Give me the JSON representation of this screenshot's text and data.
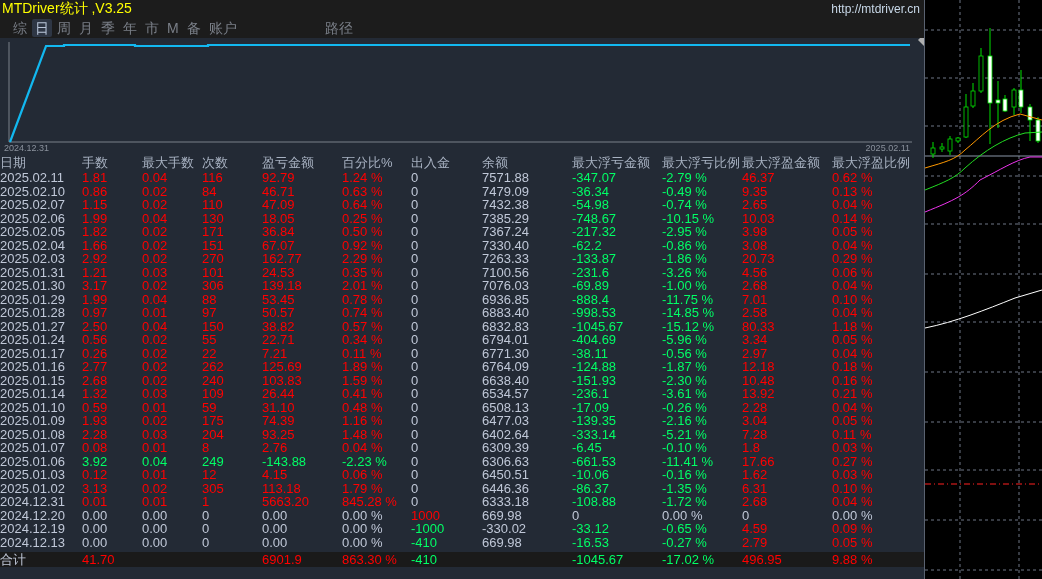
{
  "title": "MTDriver统计 ,V3.25",
  "url": "http://mtdriver.cn",
  "tabs": [
    {
      "label": "综",
      "selected": false
    },
    {
      "label": "日",
      "selected": true
    },
    {
      "label": "周",
      "selected": false
    },
    {
      "label": "月",
      "selected": false
    },
    {
      "label": "季",
      "selected": false
    },
    {
      "label": "年",
      "selected": false
    },
    {
      "label": "市",
      "selected": false
    },
    {
      "label": "M",
      "selected": false
    },
    {
      "label": "备",
      "selected": false
    },
    {
      "label": "账户",
      "selected": false
    }
  ],
  "path_button": "路径",
  "equity_chart": {
    "start_label": "2024.12.31",
    "end_label": "2025.02.11"
  },
  "table": {
    "columns": [
      "日期",
      "手数",
      "最大手数",
      "次数",
      "盈亏金额",
      "百分比%",
      "出入金",
      "余额",
      "最大浮亏金额",
      "最大浮亏比例",
      "最大浮盈金额",
      "最大浮盈比例"
    ],
    "rows": [
      {
        "cells": [
          {
            "text": "2025.02.11",
            "color": "#c0c8d8"
          },
          {
            "text": "1.81",
            "color": "#ff0000"
          },
          {
            "text": "0.04",
            "color": "#ff0000"
          },
          {
            "text": "116",
            "color": "#ff0000"
          },
          {
            "text": "92.79",
            "color": "#ff0000"
          },
          {
            "text": "1.24 %",
            "color": "#ff0000"
          },
          {
            "text": "0",
            "color": "#c0c8d8"
          },
          {
            "text": "7571.88",
            "color": "#c0c8d8"
          },
          {
            "text": "-347.07",
            "color": "#00ff66"
          },
          {
            "text": "-2.79 %",
            "color": "#00ff66"
          },
          {
            "text": "46.37",
            "color": "#ff0000"
          },
          {
            "text": "0.62 %",
            "color": "#ff0000"
          }
        ]
      },
      {
        "cells": [
          {
            "text": "2025.02.10",
            "color": "#c0c8d8"
          },
          {
            "text": "0.86",
            "color": "#ff0000"
          },
          {
            "text": "0.02",
            "color": "#ff0000"
          },
          {
            "text": "84",
            "color": "#ff0000"
          },
          {
            "text": "46.71",
            "color": "#ff0000"
          },
          {
            "text": "0.63 %",
            "color": "#ff0000"
          },
          {
            "text": "0",
            "color": "#c0c8d8"
          },
          {
            "text": "7479.09",
            "color": "#c0c8d8"
          },
          {
            "text": "-36.34",
            "color": "#00ff66"
          },
          {
            "text": "-0.49 %",
            "color": "#00ff66"
          },
          {
            "text": "9.35",
            "color": "#ff0000"
          },
          {
            "text": "0.13 %",
            "color": "#ff0000"
          }
        ]
      },
      {
        "cells": [
          {
            "text": "2025.02.07",
            "color": "#c0c8d8"
          },
          {
            "text": "1.15",
            "color": "#ff0000"
          },
          {
            "text": "0.02",
            "color": "#ff0000"
          },
          {
            "text": "110",
            "color": "#ff0000"
          },
          {
            "text": "47.09",
            "color": "#ff0000"
          },
          {
            "text": "0.64 %",
            "color": "#ff0000"
          },
          {
            "text": "0",
            "color": "#c0c8d8"
          },
          {
            "text": "7432.38",
            "color": "#c0c8d8"
          },
          {
            "text": "-54.98",
            "color": "#00ff66"
          },
          {
            "text": "-0.74 %",
            "color": "#00ff66"
          },
          {
            "text": "2.65",
            "color": "#ff0000"
          },
          {
            "text": "0.04 %",
            "color": "#ff0000"
          }
        ]
      },
      {
        "cells": [
          {
            "text": "2025.02.06",
            "color": "#c0c8d8"
          },
          {
            "text": "1.99",
            "color": "#ff0000"
          },
          {
            "text": "0.04",
            "color": "#ff0000"
          },
          {
            "text": "130",
            "color": "#ff0000"
          },
          {
            "text": "18.05",
            "color": "#ff0000"
          },
          {
            "text": "0.25 %",
            "color": "#ff0000"
          },
          {
            "text": "0",
            "color": "#c0c8d8"
          },
          {
            "text": "7385.29",
            "color": "#c0c8d8"
          },
          {
            "text": "-748.67",
            "color": "#00ff66"
          },
          {
            "text": "-10.15 %",
            "color": "#00ff66"
          },
          {
            "text": "10.03",
            "color": "#ff0000"
          },
          {
            "text": "0.14 %",
            "color": "#ff0000"
          }
        ]
      },
      {
        "cells": [
          {
            "text": "2025.02.05",
            "color": "#c0c8d8"
          },
          {
            "text": "1.82",
            "color": "#ff0000"
          },
          {
            "text": "0.02",
            "color": "#ff0000"
          },
          {
            "text": "171",
            "color": "#ff0000"
          },
          {
            "text": "36.84",
            "color": "#ff0000"
          },
          {
            "text": "0.50 %",
            "color": "#ff0000"
          },
          {
            "text": "0",
            "color": "#c0c8d8"
          },
          {
            "text": "7367.24",
            "color": "#c0c8d8"
          },
          {
            "text": "-217.32",
            "color": "#00ff66"
          },
          {
            "text": "-2.95 %",
            "color": "#00ff66"
          },
          {
            "text": "3.98",
            "color": "#ff0000"
          },
          {
            "text": "0.05 %",
            "color": "#ff0000"
          }
        ]
      },
      {
        "cells": [
          {
            "text": "2025.02.04",
            "color": "#c0c8d8"
          },
          {
            "text": "1.66",
            "color": "#ff0000"
          },
          {
            "text": "0.02",
            "color": "#ff0000"
          },
          {
            "text": "151",
            "color": "#ff0000"
          },
          {
            "text": "67.07",
            "color": "#ff0000"
          },
          {
            "text": "0.92 %",
            "color": "#ff0000"
          },
          {
            "text": "0",
            "color": "#c0c8d8"
          },
          {
            "text": "7330.40",
            "color": "#c0c8d8"
          },
          {
            "text": "-62.2",
            "color": "#00ff66"
          },
          {
            "text": "-0.86 %",
            "color": "#00ff66"
          },
          {
            "text": "3.08",
            "color": "#ff0000"
          },
          {
            "text": "0.04 %",
            "color": "#ff0000"
          }
        ]
      },
      {
        "cells": [
          {
            "text": "2025.02.03",
            "color": "#c0c8d8"
          },
          {
            "text": "2.92",
            "color": "#ff0000"
          },
          {
            "text": "0.02",
            "color": "#ff0000"
          },
          {
            "text": "270",
            "color": "#ff0000"
          },
          {
            "text": "162.77",
            "color": "#ff0000"
          },
          {
            "text": "2.29 %",
            "color": "#ff0000"
          },
          {
            "text": "0",
            "color": "#c0c8d8"
          },
          {
            "text": "7263.33",
            "color": "#c0c8d8"
          },
          {
            "text": "-133.87",
            "color": "#00ff66"
          },
          {
            "text": "-1.86 %",
            "color": "#00ff66"
          },
          {
            "text": "20.73",
            "color": "#ff0000"
          },
          {
            "text": "0.29 %",
            "color": "#ff0000"
          }
        ]
      },
      {
        "cells": [
          {
            "text": "2025.01.31",
            "color": "#c0c8d8"
          },
          {
            "text": "1.21",
            "color": "#ff0000"
          },
          {
            "text": "0.03",
            "color": "#ff0000"
          },
          {
            "text": "101",
            "color": "#ff0000"
          },
          {
            "text": "24.53",
            "color": "#ff0000"
          },
          {
            "text": "0.35 %",
            "color": "#ff0000"
          },
          {
            "text": "0",
            "color": "#c0c8d8"
          },
          {
            "text": "7100.56",
            "color": "#c0c8d8"
          },
          {
            "text": "-231.6",
            "color": "#00ff66"
          },
          {
            "text": "-3.26 %",
            "color": "#00ff66"
          },
          {
            "text": "4.56",
            "color": "#ff0000"
          },
          {
            "text": "0.06 %",
            "color": "#ff0000"
          }
        ]
      },
      {
        "cells": [
          {
            "text": "2025.01.30",
            "color": "#c0c8d8"
          },
          {
            "text": "3.17",
            "color": "#ff0000"
          },
          {
            "text": "0.02",
            "color": "#ff0000"
          },
          {
            "text": "306",
            "color": "#ff0000"
          },
          {
            "text": "139.18",
            "color": "#ff0000"
          },
          {
            "text": "2.01 %",
            "color": "#ff0000"
          },
          {
            "text": "0",
            "color": "#c0c8d8"
          },
          {
            "text": "7076.03",
            "color": "#c0c8d8"
          },
          {
            "text": "-69.89",
            "color": "#00ff66"
          },
          {
            "text": "-1.00 %",
            "color": "#00ff66"
          },
          {
            "text": "2.68",
            "color": "#ff0000"
          },
          {
            "text": "0.04 %",
            "color": "#ff0000"
          }
        ]
      },
      {
        "cells": [
          {
            "text": "2025.01.29",
            "color": "#c0c8d8"
          },
          {
            "text": "1.99",
            "color": "#ff0000"
          },
          {
            "text": "0.04",
            "color": "#ff0000"
          },
          {
            "text": "88",
            "color": "#ff0000"
          },
          {
            "text": "53.45",
            "color": "#ff0000"
          },
          {
            "text": "0.78 %",
            "color": "#ff0000"
          },
          {
            "text": "0",
            "color": "#c0c8d8"
          },
          {
            "text": "6936.85",
            "color": "#c0c8d8"
          },
          {
            "text": "-888.4",
            "color": "#00ff66"
          },
          {
            "text": "-11.75 %",
            "color": "#00ff66"
          },
          {
            "text": "7.01",
            "color": "#ff0000"
          },
          {
            "text": "0.10 %",
            "color": "#ff0000"
          }
        ]
      },
      {
        "cells": [
          {
            "text": "2025.01.28",
            "color": "#c0c8d8"
          },
          {
            "text": "0.97",
            "color": "#ff0000"
          },
          {
            "text": "0.01",
            "color": "#ff0000"
          },
          {
            "text": "97",
            "color": "#ff0000"
          },
          {
            "text": "50.57",
            "color": "#ff0000"
          },
          {
            "text": "0.74 %",
            "color": "#ff0000"
          },
          {
            "text": "0",
            "color": "#c0c8d8"
          },
          {
            "text": "6883.40",
            "color": "#c0c8d8"
          },
          {
            "text": "-998.53",
            "color": "#00ff66"
          },
          {
            "text": "-14.85 %",
            "color": "#00ff66"
          },
          {
            "text": "2.58",
            "color": "#ff0000"
          },
          {
            "text": "0.04 %",
            "color": "#ff0000"
          }
        ]
      },
      {
        "cells": [
          {
            "text": "2025.01.27",
            "color": "#c0c8d8"
          },
          {
            "text": "2.50",
            "color": "#ff0000"
          },
          {
            "text": "0.04",
            "color": "#ff0000"
          },
          {
            "text": "150",
            "color": "#ff0000"
          },
          {
            "text": "38.82",
            "color": "#ff0000"
          },
          {
            "text": "0.57 %",
            "color": "#ff0000"
          },
          {
            "text": "0",
            "color": "#c0c8d8"
          },
          {
            "text": "6832.83",
            "color": "#c0c8d8"
          },
          {
            "text": "-1045.67",
            "color": "#00ff66"
          },
          {
            "text": "-15.12 %",
            "color": "#00ff66"
          },
          {
            "text": "80.33",
            "color": "#ff0000"
          },
          {
            "text": "1.18 %",
            "color": "#ff0000"
          }
        ]
      },
      {
        "cells": [
          {
            "text": "2025.01.24",
            "color": "#c0c8d8"
          },
          {
            "text": "0.56",
            "color": "#ff0000"
          },
          {
            "text": "0.02",
            "color": "#ff0000"
          },
          {
            "text": "55",
            "color": "#ff0000"
          },
          {
            "text": "22.71",
            "color": "#ff0000"
          },
          {
            "text": "0.34 %",
            "color": "#ff0000"
          },
          {
            "text": "0",
            "color": "#c0c8d8"
          },
          {
            "text": "6794.01",
            "color": "#c0c8d8"
          },
          {
            "text": "-404.69",
            "color": "#00ff66"
          },
          {
            "text": "-5.96 %",
            "color": "#00ff66"
          },
          {
            "text": "3.34",
            "color": "#ff0000"
          },
          {
            "text": "0.05 %",
            "color": "#ff0000"
          }
        ]
      },
      {
        "cells": [
          {
            "text": "2025.01.17",
            "color": "#c0c8d8"
          },
          {
            "text": "0.26",
            "color": "#ff0000"
          },
          {
            "text": "0.02",
            "color": "#ff0000"
          },
          {
            "text": "22",
            "color": "#ff0000"
          },
          {
            "text": "7.21",
            "color": "#ff0000"
          },
          {
            "text": "0.11 %",
            "color": "#ff0000"
          },
          {
            "text": "0",
            "color": "#c0c8d8"
          },
          {
            "text": "6771.30",
            "color": "#c0c8d8"
          },
          {
            "text": "-38.11",
            "color": "#00ff66"
          },
          {
            "text": "-0.56 %",
            "color": "#00ff66"
          },
          {
            "text": "2.97",
            "color": "#ff0000"
          },
          {
            "text": "0.04 %",
            "color": "#ff0000"
          }
        ]
      },
      {
        "cells": [
          {
            "text": "2025.01.16",
            "color": "#c0c8d8"
          },
          {
            "text": "2.77",
            "color": "#ff0000"
          },
          {
            "text": "0.02",
            "color": "#ff0000"
          },
          {
            "text": "262",
            "color": "#ff0000"
          },
          {
            "text": "125.69",
            "color": "#ff0000"
          },
          {
            "text": "1.89 %",
            "color": "#ff0000"
          },
          {
            "text": "0",
            "color": "#c0c8d8"
          },
          {
            "text": "6764.09",
            "color": "#c0c8d8"
          },
          {
            "text": "-124.88",
            "color": "#00ff66"
          },
          {
            "text": "-1.87 %",
            "color": "#00ff66"
          },
          {
            "text": "12.18",
            "color": "#ff0000"
          },
          {
            "text": "0.18 %",
            "color": "#ff0000"
          }
        ]
      },
      {
        "cells": [
          {
            "text": "2025.01.15",
            "color": "#c0c8d8"
          },
          {
            "text": "2.68",
            "color": "#ff0000"
          },
          {
            "text": "0.02",
            "color": "#ff0000"
          },
          {
            "text": "240",
            "color": "#ff0000"
          },
          {
            "text": "103.83",
            "color": "#ff0000"
          },
          {
            "text": "1.59 %",
            "color": "#ff0000"
          },
          {
            "text": "0",
            "color": "#c0c8d8"
          },
          {
            "text": "6638.40",
            "color": "#c0c8d8"
          },
          {
            "text": "-151.93",
            "color": "#00ff66"
          },
          {
            "text": "-2.30 %",
            "color": "#00ff66"
          },
          {
            "text": "10.48",
            "color": "#ff0000"
          },
          {
            "text": "0.16 %",
            "color": "#ff0000"
          }
        ]
      },
      {
        "cells": [
          {
            "text": "2025.01.14",
            "color": "#c0c8d8"
          },
          {
            "text": "1.32",
            "color": "#ff0000"
          },
          {
            "text": "0.03",
            "color": "#ff0000"
          },
          {
            "text": "109",
            "color": "#ff0000"
          },
          {
            "text": "26.44",
            "color": "#ff0000"
          },
          {
            "text": "0.41 %",
            "color": "#ff0000"
          },
          {
            "text": "0",
            "color": "#c0c8d8"
          },
          {
            "text": "6534.57",
            "color": "#c0c8d8"
          },
          {
            "text": "-236.1",
            "color": "#00ff66"
          },
          {
            "text": "-3.61 %",
            "color": "#00ff66"
          },
          {
            "text": "13.92",
            "color": "#ff0000"
          },
          {
            "text": "0.21 %",
            "color": "#ff0000"
          }
        ]
      },
      {
        "cells": [
          {
            "text": "2025.01.10",
            "color": "#c0c8d8"
          },
          {
            "text": "0.59",
            "color": "#ff0000"
          },
          {
            "text": "0.01",
            "color": "#ff0000"
          },
          {
            "text": "59",
            "color": "#ff0000"
          },
          {
            "text": "31.10",
            "color": "#ff0000"
          },
          {
            "text": "0.48 %",
            "color": "#ff0000"
          },
          {
            "text": "0",
            "color": "#c0c8d8"
          },
          {
            "text": "6508.13",
            "color": "#c0c8d8"
          },
          {
            "text": "-17.09",
            "color": "#00ff66"
          },
          {
            "text": "-0.26 %",
            "color": "#00ff66"
          },
          {
            "text": "2.28",
            "color": "#ff0000"
          },
          {
            "text": "0.04 %",
            "color": "#ff0000"
          }
        ]
      },
      {
        "cells": [
          {
            "text": "2025.01.09",
            "color": "#c0c8d8"
          },
          {
            "text": "1.93",
            "color": "#ff0000"
          },
          {
            "text": "0.02",
            "color": "#ff0000"
          },
          {
            "text": "175",
            "color": "#ff0000"
          },
          {
            "text": "74.39",
            "color": "#ff0000"
          },
          {
            "text": "1.16 %",
            "color": "#ff0000"
          },
          {
            "text": "0",
            "color": "#c0c8d8"
          },
          {
            "text": "6477.03",
            "color": "#c0c8d8"
          },
          {
            "text": "-139.35",
            "color": "#00ff66"
          },
          {
            "text": "-2.16 %",
            "color": "#00ff66"
          },
          {
            "text": "3.04",
            "color": "#ff0000"
          },
          {
            "text": "0.05 %",
            "color": "#ff0000"
          }
        ]
      },
      {
        "cells": [
          {
            "text": "2025.01.08",
            "color": "#c0c8d8"
          },
          {
            "text": "2.28",
            "color": "#ff0000"
          },
          {
            "text": "0.03",
            "color": "#ff0000"
          },
          {
            "text": "204",
            "color": "#ff0000"
          },
          {
            "text": "93.25",
            "color": "#ff0000"
          },
          {
            "text": "1.48 %",
            "color": "#ff0000"
          },
          {
            "text": "0",
            "color": "#c0c8d8"
          },
          {
            "text": "6402.64",
            "color": "#c0c8d8"
          },
          {
            "text": "-333.14",
            "color": "#00ff66"
          },
          {
            "text": "-5.21 %",
            "color": "#00ff66"
          },
          {
            "text": "7.28",
            "color": "#ff0000"
          },
          {
            "text": "0.11 %",
            "color": "#ff0000"
          }
        ]
      },
      {
        "cells": [
          {
            "text": "2025.01.07",
            "color": "#c0c8d8"
          },
          {
            "text": "0.08",
            "color": "#ff0000"
          },
          {
            "text": "0.01",
            "color": "#ff0000"
          },
          {
            "text": "8",
            "color": "#ff0000"
          },
          {
            "text": "2.76",
            "color": "#ff0000"
          },
          {
            "text": "0.04 %",
            "color": "#ff0000"
          },
          {
            "text": "0",
            "color": "#c0c8d8"
          },
          {
            "text": "6309.39",
            "color": "#c0c8d8"
          },
          {
            "text": "-6.45",
            "color": "#00ff66"
          },
          {
            "text": "-0.10 %",
            "color": "#00ff66"
          },
          {
            "text": "1.8",
            "color": "#ff0000"
          },
          {
            "text": "0.03 %",
            "color": "#ff0000"
          }
        ]
      },
      {
        "cells": [
          {
            "text": "2025.01.06",
            "color": "#c0c8d8"
          },
          {
            "text": "3.92",
            "color": "#00ff66"
          },
          {
            "text": "0.04",
            "color": "#00ff66"
          },
          {
            "text": "249",
            "color": "#00ff66"
          },
          {
            "text": "-143.88",
            "color": "#00ff66"
          },
          {
            "text": "-2.23 %",
            "color": "#00ff66"
          },
          {
            "text": "0",
            "color": "#c0c8d8"
          },
          {
            "text": "6306.63",
            "color": "#c0c8d8"
          },
          {
            "text": "-661.53",
            "color": "#00ff66"
          },
          {
            "text": "-11.41 %",
            "color": "#00ff66"
          },
          {
            "text": "17.66",
            "color": "#ff0000"
          },
          {
            "text": "0.27 %",
            "color": "#ff0000"
          }
        ]
      },
      {
        "cells": [
          {
            "text": "2025.01.03",
            "color": "#c0c8d8"
          },
          {
            "text": "0.12",
            "color": "#ff0000"
          },
          {
            "text": "0.01",
            "color": "#ff0000"
          },
          {
            "text": "12",
            "color": "#ff0000"
          },
          {
            "text": "4.15",
            "color": "#ff0000"
          },
          {
            "text": "0.06 %",
            "color": "#ff0000"
          },
          {
            "text": "0",
            "color": "#c0c8d8"
          },
          {
            "text": "6450.51",
            "color": "#c0c8d8"
          },
          {
            "text": "-10.06",
            "color": "#00ff66"
          },
          {
            "text": "-0.16 %",
            "color": "#00ff66"
          },
          {
            "text": "1.62",
            "color": "#ff0000"
          },
          {
            "text": "0.03 %",
            "color": "#ff0000"
          }
        ]
      },
      {
        "cells": [
          {
            "text": "2025.01.02",
            "color": "#c0c8d8"
          },
          {
            "text": "3.13",
            "color": "#ff0000"
          },
          {
            "text": "0.02",
            "color": "#ff0000"
          },
          {
            "text": "305",
            "color": "#ff0000"
          },
          {
            "text": "113.18",
            "color": "#ff0000"
          },
          {
            "text": "1.79 %",
            "color": "#ff0000"
          },
          {
            "text": "0",
            "color": "#c0c8d8"
          },
          {
            "text": "6446.36",
            "color": "#c0c8d8"
          },
          {
            "text": "-86.37",
            "color": "#00ff66"
          },
          {
            "text": "-1.35 %",
            "color": "#00ff66"
          },
          {
            "text": "6.31",
            "color": "#ff0000"
          },
          {
            "text": "0.10 %",
            "color": "#ff0000"
          }
        ]
      },
      {
        "cells": [
          {
            "text": "2024.12.31",
            "color": "#c0c8d8"
          },
          {
            "text": "0.01",
            "color": "#ff0000"
          },
          {
            "text": "0.01",
            "color": "#ff0000"
          },
          {
            "text": "1",
            "color": "#ff0000"
          },
          {
            "text": "5663.20",
            "color": "#ff0000"
          },
          {
            "text": "845.28 %",
            "color": "#ff0000"
          },
          {
            "text": "0",
            "color": "#c0c8d8"
          },
          {
            "text": "6333.18",
            "color": "#c0c8d8"
          },
          {
            "text": "-108.88",
            "color": "#00ff66"
          },
          {
            "text": "-1.72 %",
            "color": "#00ff66"
          },
          {
            "text": "2.68",
            "color": "#ff0000"
          },
          {
            "text": "0.04 %",
            "color": "#ff0000"
          }
        ]
      },
      {
        "cells": [
          {
            "text": "2024.12.20",
            "color": "#c0c8d8"
          },
          {
            "text": "0.00",
            "color": "#c0c8d8"
          },
          {
            "text": "0.00",
            "color": "#c0c8d8"
          },
          {
            "text": "0",
            "color": "#c0c8d8"
          },
          {
            "text": "0.00",
            "color": "#c0c8d8"
          },
          {
            "text": "0.00 %",
            "color": "#c0c8d8"
          },
          {
            "text": "1000",
            "color": "#ff0000"
          },
          {
            "text": "669.98",
            "color": "#c0c8d8"
          },
          {
            "text": "0",
            "color": "#c0c8d8"
          },
          {
            "text": "0.00 %",
            "color": "#c0c8d8"
          },
          {
            "text": "0",
            "color": "#c0c8d8"
          },
          {
            "text": "0.00 %",
            "color": "#c0c8d8"
          }
        ]
      },
      {
        "cells": [
          {
            "text": "2024.12.19",
            "color": "#c0c8d8"
          },
          {
            "text": "0.00",
            "color": "#c0c8d8"
          },
          {
            "text": "0.00",
            "color": "#c0c8d8"
          },
          {
            "text": "0",
            "color": "#c0c8d8"
          },
          {
            "text": "0.00",
            "color": "#c0c8d8"
          },
          {
            "text": "0.00 %",
            "color": "#c0c8d8"
          },
          {
            "text": "-1000",
            "color": "#00ff66"
          },
          {
            "text": "-330.02",
            "color": "#c0c8d8"
          },
          {
            "text": "-33.12",
            "color": "#00ff66"
          },
          {
            "text": "-0.65 %",
            "color": "#00ff66"
          },
          {
            "text": "4.59",
            "color": "#ff0000"
          },
          {
            "text": "0.09 %",
            "color": "#ff0000"
          }
        ]
      },
      {
        "cells": [
          {
            "text": "2024.12.13",
            "color": "#c0c8d8"
          },
          {
            "text": "0.00",
            "color": "#c0c8d8"
          },
          {
            "text": "0.00",
            "color": "#c0c8d8"
          },
          {
            "text": "0",
            "color": "#c0c8d8"
          },
          {
            "text": "0.00",
            "color": "#c0c8d8"
          },
          {
            "text": "0.00 %",
            "color": "#c0c8d8"
          },
          {
            "text": "-410",
            "color": "#00ff66"
          },
          {
            "text": "669.98",
            "color": "#c0c8d8"
          },
          {
            "text": "-16.53",
            "color": "#00ff66"
          },
          {
            "text": "-0.27 %",
            "color": "#00ff66"
          },
          {
            "text": "2.79",
            "color": "#ff0000"
          },
          {
            "text": "0.05 %",
            "color": "#ff0000"
          }
        ]
      }
    ],
    "total": {
      "cells": [
        {
          "text": "合计",
          "color": "#c0c8d8"
        },
        {
          "text": "41.70",
          "color": "#ff0000"
        },
        null,
        null,
        {
          "text": "6901.9",
          "color": "#ff0000"
        },
        {
          "text": "863.30 %",
          "color": "#ff0000"
        },
        {
          "text": "-410",
          "color": "#00ff66"
        },
        null,
        {
          "text": "-1045.67",
          "color": "#00ff66"
        },
        {
          "text": "-17.02 %",
          "color": "#00ff66"
        },
        {
          "text": "496.95",
          "color": "#ff0000"
        },
        {
          "text": "9.88 %",
          "color": "#ff0000"
        }
      ]
    }
  }
}
